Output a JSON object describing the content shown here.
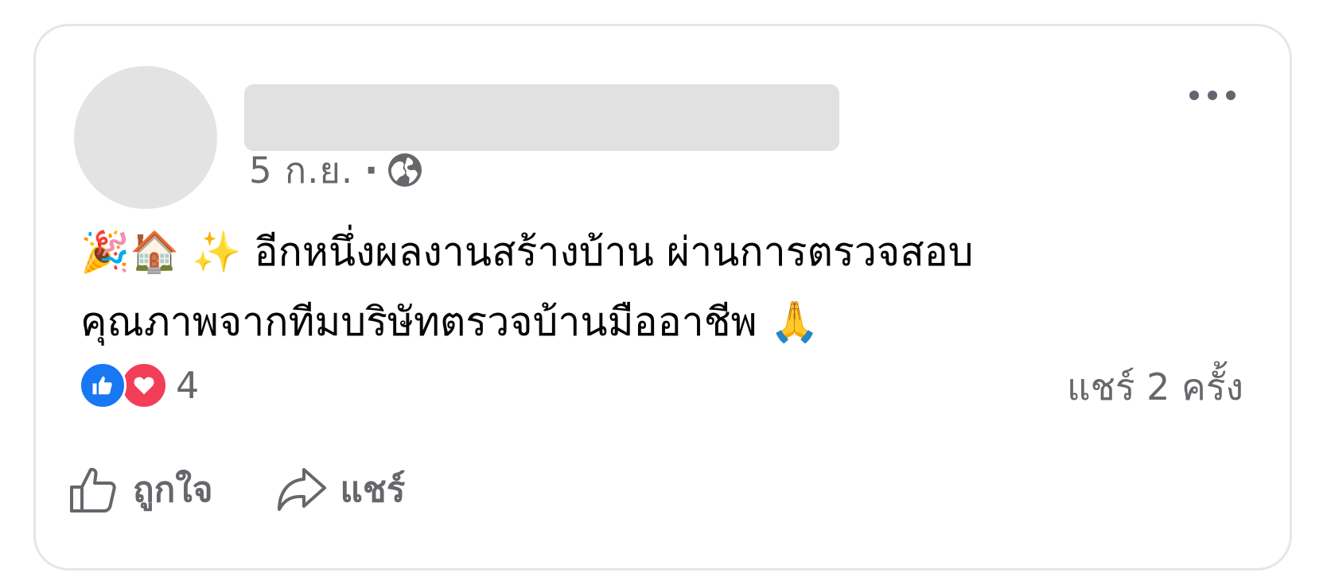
{
  "post": {
    "author_name": "",
    "timestamp": "5 ก.ย.",
    "separator": "·",
    "audience_icon": "globe-icon",
    "more_icon": "more-options-icon",
    "text_line1": "🎉🏠 ✨ อีกหนึ่งผลงานสร้างบ้าน ผ่านการตรวจสอบ",
    "text_line2": "คุณภาพจากทีมบริษัทตรวจบ้านมืออาชีพ 🙏"
  },
  "reactions": {
    "icons": [
      "like-reaction-icon",
      "love-reaction-icon"
    ],
    "count": "4",
    "shares_label": "แชร์ 2 ครั้ง"
  },
  "actions": {
    "like_label": "ถูกใจ",
    "share_label": "แชร์"
  },
  "colors": {
    "like_blue": "#1877f2",
    "love_red": "#f33e58",
    "secondary_text": "#65676b",
    "primary_text": "#050505",
    "card_border": "#e4e6eb",
    "placeholder_gray": "#e1e1e1"
  }
}
